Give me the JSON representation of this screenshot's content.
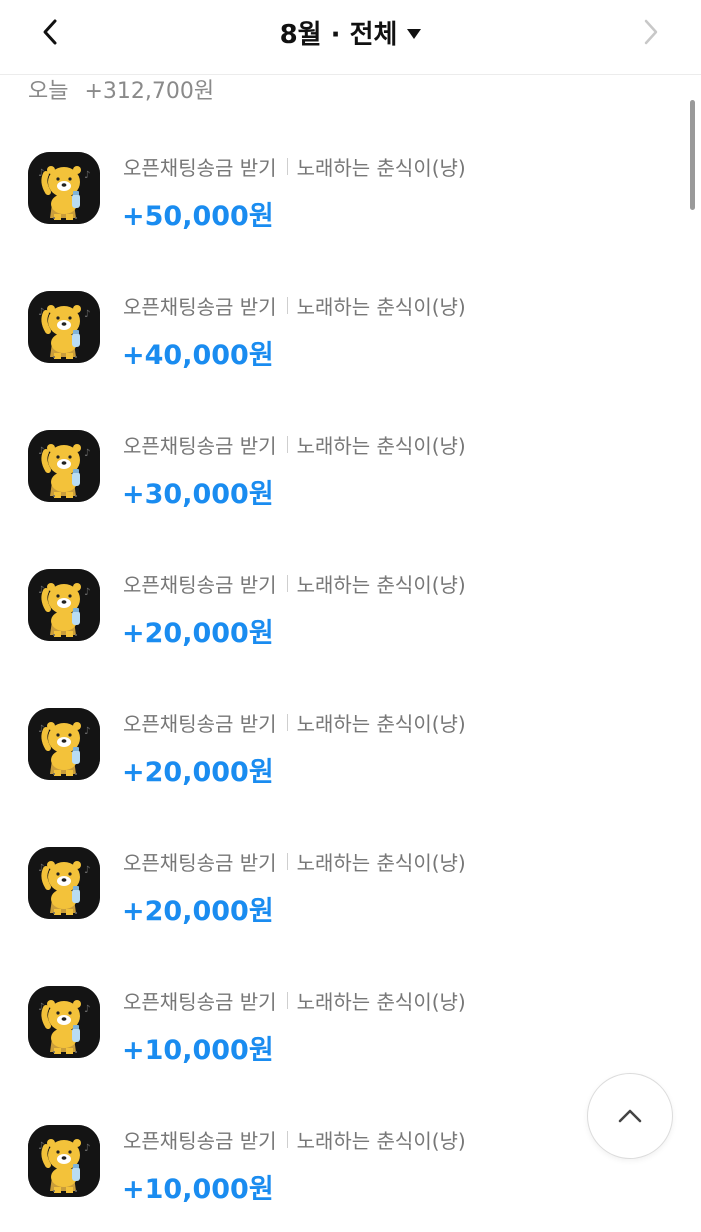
{
  "header": {
    "title": "8월 · 전체",
    "back_icon": "chevron-left-icon",
    "next_icon": "chevron-right-icon",
    "dropdown_icon": "caret-down-icon"
  },
  "today_summary": {
    "label": "오늘",
    "amount": "+312,700원"
  },
  "transactions": [
    {
      "type": "오픈채팅송금 받기",
      "counterparty": "노래하는 춘식이(냥)",
      "amount": "+50,000원"
    },
    {
      "type": "오픈채팅송금 받기",
      "counterparty": "노래하는 춘식이(냥)",
      "amount": "+40,000원"
    },
    {
      "type": "오픈채팅송금 받기",
      "counterparty": "노래하는 춘식이(냥)",
      "amount": "+30,000원"
    },
    {
      "type": "오픈채팅송금 받기",
      "counterparty": "노래하는 춘식이(냥)",
      "amount": "+20,000원"
    },
    {
      "type": "오픈채팅송금 받기",
      "counterparty": "노래하는 춘식이(냥)",
      "amount": "+20,000원"
    },
    {
      "type": "오픈채팅송금 받기",
      "counterparty": "노래하는 춘식이(냥)",
      "amount": "+20,000원"
    },
    {
      "type": "오픈채팅송금 받기",
      "counterparty": "노래하는 춘식이(냥)",
      "amount": "+10,000원"
    },
    {
      "type": "오픈채팅송금 받기",
      "counterparty": "노래하는 춘식이(냥)",
      "amount": "+10,000원"
    }
  ],
  "scroll_top_icon": "chevron-up-icon",
  "colors": {
    "amount": "#1a8cf0",
    "secondary_text": "#777777",
    "avatar_bg": "#141414",
    "character": "#f3c23a"
  }
}
